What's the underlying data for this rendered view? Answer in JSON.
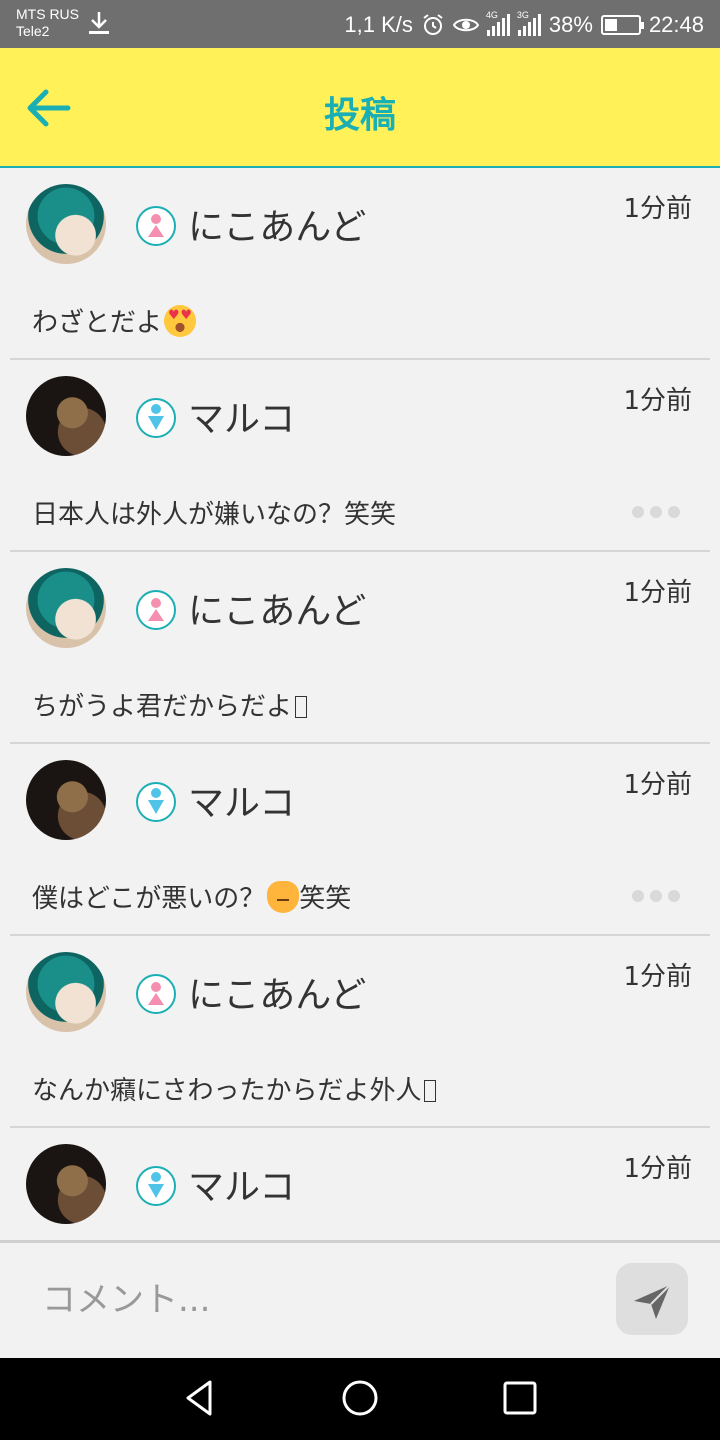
{
  "status_bar": {
    "carrier_primary": "MTS RUS",
    "carrier_secondary": "Tele2",
    "speed": "1,1 K/s",
    "battery": "38%",
    "battery_level": 0.38,
    "time": "22:48",
    "net_4g": "4G",
    "net_3g": "3G"
  },
  "header": {
    "title": "投稿",
    "accent_color": "#1aafb5",
    "background": "#fff157"
  },
  "posts": [
    {
      "username": "にこあんど",
      "gender": "female",
      "time": "1分前",
      "message": "わざとだよ",
      "emoji": "heart-eyes-emoji",
      "show_more": false
    },
    {
      "username": "マルコ",
      "gender": "male",
      "time": "1分前",
      "message": "日本人は外人が嫌いなの？笑笑",
      "emoji": "",
      "show_more": true
    },
    {
      "username": "にこあんど",
      "gender": "female",
      "time": "1分前",
      "message": "ちがうよ君だからだよ",
      "emoji": "missing-glyph",
      "show_more": false
    },
    {
      "username": "マルコ",
      "gender": "male",
      "time": "1分前",
      "message_before": "僕はどこが悪いの？",
      "emoji": "crying-cat-emoji",
      "message_after": "笑笑",
      "show_more": true
    },
    {
      "username": "にこあんど",
      "gender": "female",
      "time": "1分前",
      "message": "なんか癪にさわったからだよ外人",
      "emoji": "missing-glyph",
      "show_more": false
    },
    {
      "username": "マルコ",
      "gender": "male",
      "time": "1分前",
      "message": "",
      "show_more": false
    }
  ],
  "comment": {
    "placeholder": "コメント...",
    "send_icon": "send-icon"
  },
  "colors": {
    "female": "#f58fb0",
    "male": "#4fc3e8",
    "nav_bar": "#000000"
  }
}
